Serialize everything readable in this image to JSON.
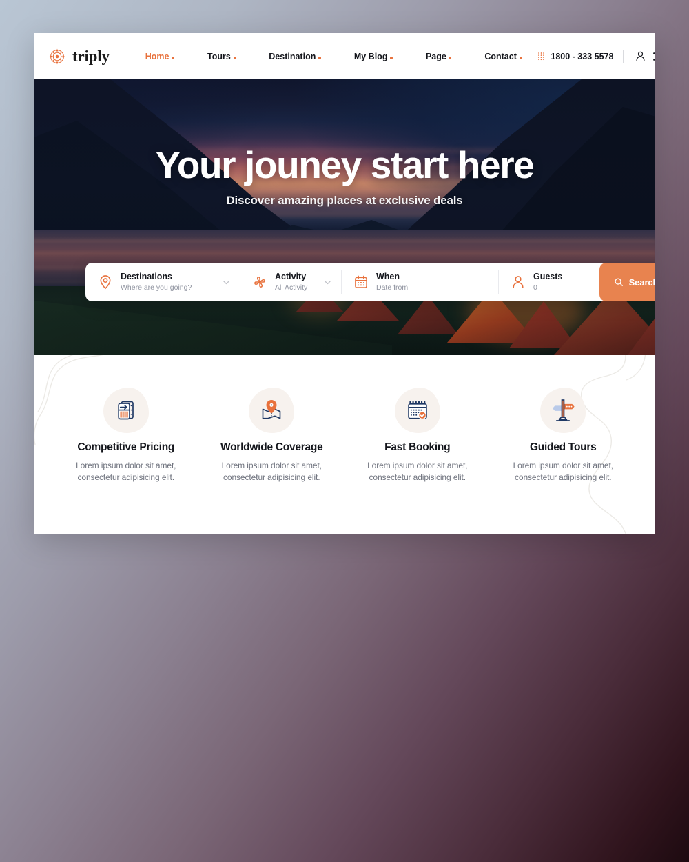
{
  "brand": {
    "name": "triply",
    "logo_icon": "compass-rosette-icon"
  },
  "header": {
    "nav_items": [
      {
        "label": "Home",
        "active": true
      },
      {
        "label": "Tours",
        "active": false
      },
      {
        "label": "Destination",
        "active": false
      },
      {
        "label": "My Blog",
        "active": false
      },
      {
        "label": "Page",
        "active": false
      },
      {
        "label": "Contact",
        "active": false
      }
    ],
    "phone": "1800 - 333 5578",
    "phone_icon": "dot-grid-icon",
    "account_icon": "user-icon",
    "menu_icon": "hamburger-menu-icon"
  },
  "hero": {
    "title": "Your jouney start here",
    "subtitle": "Discover amazing places at exclusive deals"
  },
  "search": {
    "fields": [
      {
        "icon": "map-pin-icon",
        "label": "Destinations",
        "value": "Where are you going?",
        "caret": true
      },
      {
        "icon": "pinwheel-icon",
        "label": "Activity",
        "value": "All Activity",
        "caret": true
      },
      {
        "icon": "calendar-icon",
        "label": "When",
        "value": "Date from",
        "caret": false
      },
      {
        "icon": "person-icon",
        "label": "Guests",
        "value": "0",
        "caret": false
      }
    ],
    "button_label": "Search",
    "button_icon": "search-icon",
    "button_color": "#e8834f"
  },
  "features": [
    {
      "icon": "ticket-plane-icon",
      "title": "Competitive Pricing",
      "desc": "Lorem ipsum dolor sit amet, consectetur adipisicing elit."
    },
    {
      "icon": "map-location-icon",
      "title": "Worldwide Coverage",
      "desc": "Lorem ipsum dolor sit amet, consectetur adipisicing elit."
    },
    {
      "icon": "calendar-check-icon",
      "title": "Fast Booking",
      "desc": "Lorem ipsum dolor sit amet, consectetur adipisicing elit."
    },
    {
      "icon": "signpost-icon",
      "title": "Guided Tours",
      "desc": "Lorem ipsum dolor sit amet, consectetur adipisicing elit."
    }
  ],
  "theme": {
    "accent": "#e8713c",
    "accent_button": "#e8834f",
    "ink": "#14161c",
    "muted": "#6f737e",
    "blob": "#f7f2ee",
    "icon_navy": "#1f3864"
  }
}
